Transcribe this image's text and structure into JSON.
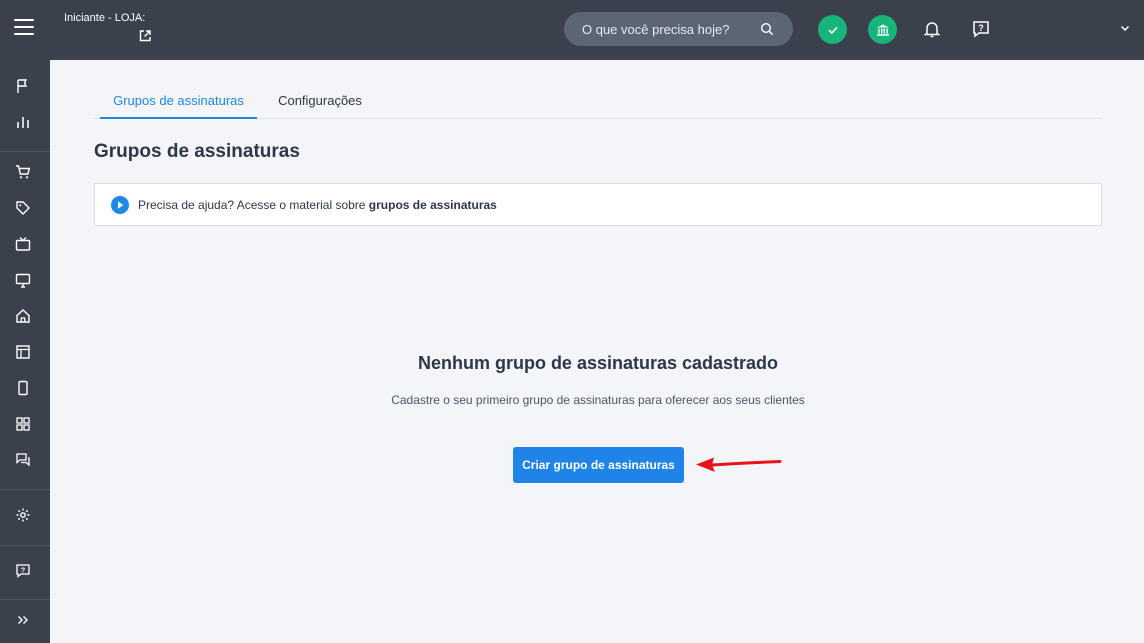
{
  "topbar": {
    "store_label": "Iniciante - LOJA:",
    "search_placeholder": "O que você precisa hoje?",
    "icons": [
      "menu-icon",
      "external-link-icon",
      "search-icon",
      "check-icon",
      "bank-icon",
      "bell-icon",
      "help-chat-icon",
      "chevron-down-icon"
    ],
    "status_color": "#18b57a"
  },
  "sidebar": {
    "items": [
      "flag-icon",
      "bar-chart-icon",
      "cart-icon",
      "tag-icon",
      "tv-icon",
      "monitor-icon",
      "home-icon",
      "layout-icon",
      "mobile-icon",
      "apps-icon",
      "chat-icon",
      "gear-icon",
      "help-chat-icon",
      "expand-icon"
    ]
  },
  "tabs": [
    {
      "label": "Grupos de assinaturas",
      "active": true
    },
    {
      "label": "Configurações",
      "active": false
    }
  ],
  "page": {
    "title": "Grupos de assinaturas"
  },
  "help": {
    "text": "Precisa de ajuda? Acesse o material sobre ",
    "link": "grupos de assinaturas"
  },
  "empty_state": {
    "title": "Nenhum grupo de assinaturas cadastrado",
    "description": "Cadastre o seu primeiro grupo de assinaturas para oferecer aos seus clientes",
    "button_label": "Criar grupo de assinaturas"
  },
  "colors": {
    "accent": "#1e88e5",
    "annotation_arrow": "#e8141a",
    "chrome": "#3a414c"
  }
}
